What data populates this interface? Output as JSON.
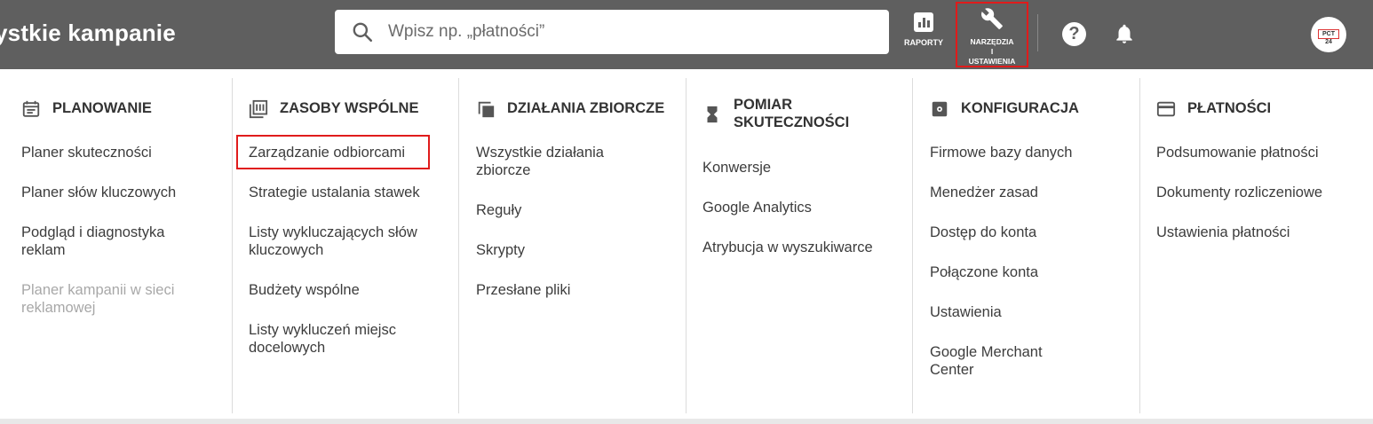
{
  "topbar": {
    "title": "ystkie kampanie",
    "search": {
      "placeholder": "Wpisz np. „płatności”",
      "value": ""
    },
    "reports_label": "RAPORTY",
    "tools_label_1": "NARZĘDZIA",
    "tools_label_2": "I",
    "tools_label_3": "USTAWIENIA",
    "help_label": "?",
    "avatar_text": "PCT 24"
  },
  "menu": {
    "columns": [
      {
        "heading": "PLANOWANIE",
        "icon": "calendar-icon",
        "items": [
          "Planer skuteczności",
          "Planer słów kluczowych",
          "Podgląd i diagnostyka",
          "reklam",
          "Planer kampanii w sieci",
          "reklamowej"
        ]
      },
      {
        "heading": "ZASOBY WSPÓLNE",
        "icon": "library-icon",
        "items": [
          "Zarządzanie odbiorcami",
          "Strategie ustalania stawek",
          "Listy wykluczających słów",
          "kluczowych",
          "Budżety wspólne",
          "Listy wykluczeń miejsc",
          "docelowych"
        ]
      },
      {
        "heading": "DZIAŁANIA ZBIORCZE",
        "icon": "copy-icon",
        "items": [
          "Wszystkie działania",
          "zbiorcze",
          "Reguły",
          "Skrypty",
          "Przesłane pliki"
        ]
      },
      {
        "heading_1": "POMIAR",
        "heading_2": "SKUTECZNOŚCI",
        "icon": "hourglass-icon",
        "items": [
          "Konwersje",
          "Google Analytics",
          "Atrybucja w wyszukiwarce"
        ]
      },
      {
        "heading": "KONFIGURACJA",
        "icon": "settings-icon",
        "items": [
          "Firmowe bazy danych",
          "Menedżer zasad",
          "Dostęp do konta",
          "Połączone konta",
          "Ustawienia",
          "Google Merchant",
          "Center"
        ]
      },
      {
        "heading": "PŁATNOŚCI",
        "icon": "credit-card-icon",
        "items": [
          "Podsumowanie płatności",
          "Dokumenty rozliczeniowe",
          "Ustawienia płatności"
        ]
      }
    ]
  },
  "colors": {
    "topbar": "#5f5f5f",
    "highlight": "#e01b1b",
    "disabled": "#a8a8a8"
  }
}
